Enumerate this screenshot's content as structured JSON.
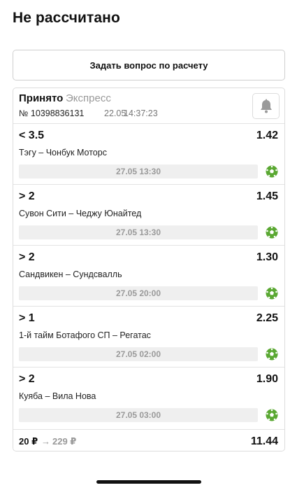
{
  "page": {
    "title": "Не рассчитано"
  },
  "ask_button": {
    "label": "Задать вопрос по расчету"
  },
  "bet": {
    "status": "Принято",
    "type": "Экспресс",
    "number": "№ 10398836131",
    "date": "22.05",
    "time": "14:37:23",
    "bell_icon": "bell-icon",
    "events": [
      {
        "outcome": "< 3.5",
        "odds": "1.42",
        "match": "Тэгу – Чонбук Моторс",
        "start": "27.05 13:30",
        "sport_icon": "soccer-ball-icon"
      },
      {
        "outcome": "> 2",
        "odds": "1.45",
        "match": "Сувон Сити – Чеджу Юнайтед",
        "start": "27.05 13:30",
        "sport_icon": "soccer-ball-icon"
      },
      {
        "outcome": "> 2",
        "odds": "1.30",
        "match": "Сандвикен – Сундсвалль",
        "start": "27.05 20:00",
        "sport_icon": "soccer-ball-icon"
      },
      {
        "outcome": "> 1",
        "odds": "2.25",
        "match": "1-й тайм Ботафого СП – Регатас",
        "start": "27.05 02:00",
        "sport_icon": "soccer-ball-icon"
      },
      {
        "outcome": "> 2",
        "odds": "1.90",
        "match": "Куяба – Вила Нова",
        "start": "27.05 03:00",
        "sport_icon": "soccer-ball-icon"
      }
    ],
    "stake": "20 ₽",
    "arrow": "→",
    "payout": "229 ₽",
    "total_odds": "11.44"
  },
  "colors": {
    "ball_green": "#5aa832",
    "muted_text": "#999999",
    "date_bar_bg": "#efefef"
  }
}
